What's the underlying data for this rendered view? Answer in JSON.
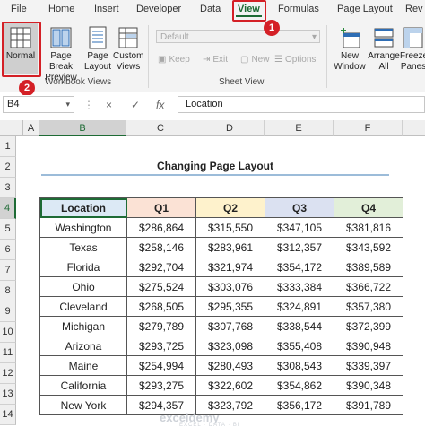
{
  "tabs": [
    "File",
    "Home",
    "Insert",
    "Developer",
    "Data",
    "View",
    "Formulas",
    "Page Layout",
    "Rev"
  ],
  "active_tab": "View",
  "step_badges": [
    "1",
    "2"
  ],
  "ribbon": {
    "workbook_views": {
      "label": "Workbook Views",
      "normal": "Normal",
      "page_break": [
        "Page Break",
        "Preview"
      ],
      "page_layout": [
        "Page",
        "Layout"
      ],
      "custom_views": [
        "Custom",
        "Views"
      ]
    },
    "sheet_view": {
      "label": "Sheet View",
      "dropdown_value": "Default",
      "keep": "Keep",
      "exit": "Exit",
      "new": "New",
      "options": "Options"
    },
    "window": {
      "new_window": [
        "New",
        "Window"
      ],
      "arrange_all": [
        "Arrange",
        "All"
      ],
      "freeze_panes": [
        "Freeze",
        "Panes"
      ]
    }
  },
  "formula_bar": {
    "name_box": "B4",
    "cancel": "×",
    "enter": "✓",
    "fx": "fx",
    "content": "Location"
  },
  "columns": [
    "A",
    "B",
    "C",
    "D",
    "E",
    "F"
  ],
  "rows": [
    "1",
    "2",
    "3",
    "4",
    "5",
    "6",
    "7",
    "8",
    "9",
    "10",
    "11",
    "12",
    "13",
    "14"
  ],
  "selected_cell": "B4",
  "sheet": {
    "title": "Changing Page Layout",
    "headers": [
      "Location",
      "Q1",
      "Q2",
      "Q3",
      "Q4"
    ],
    "rows": [
      [
        "Washington",
        "$286,864",
        "$315,550",
        "$347,105",
        "$381,816"
      ],
      [
        "Texas",
        "$258,146",
        "$283,961",
        "$312,357",
        "$343,592"
      ],
      [
        "Florida",
        "$292,704",
        "$321,974",
        "$354,172",
        "$389,589"
      ],
      [
        "Ohio",
        "$275,524",
        "$303,076",
        "$333,384",
        "$366,722"
      ],
      [
        "Cleveland",
        "$268,505",
        "$295,355",
        "$324,891",
        "$357,380"
      ],
      [
        "Michigan",
        "$279,789",
        "$307,768",
        "$338,544",
        "$372,399"
      ],
      [
        "Arizona",
        "$293,725",
        "$323,098",
        "$355,408",
        "$390,948"
      ],
      [
        "Maine",
        "$254,994",
        "$280,493",
        "$308,543",
        "$339,397"
      ],
      [
        "California",
        "$293,275",
        "$322,602",
        "$354,862",
        "$390,348"
      ],
      [
        "New York",
        "$294,357",
        "$323,792",
        "$356,172",
        "$391,789"
      ]
    ]
  },
  "watermark": {
    "name": "exceldemy",
    "tagline": "EXCEL · DATA · BI"
  },
  "colors": {
    "accent": "#1e6b35",
    "highlight": "#d42026"
  }
}
